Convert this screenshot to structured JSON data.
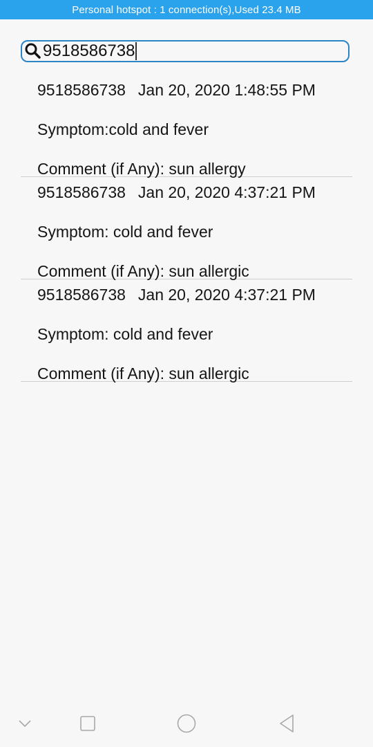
{
  "status_bar": {
    "text": "Personal hotspot : 1 connection(s),Used  23.4 MB",
    "color": "#2aa3ec"
  },
  "search": {
    "icon": "search-icon",
    "value": "9518586738"
  },
  "records": [
    {
      "phone": "9518586738",
      "datetime": "Jan 20, 2020 1:48:55 PM",
      "symptom": "Symptom:cold and fever",
      "comment": "Comment (if Any): sun allergy"
    },
    {
      "phone": "9518586738",
      "datetime": "Jan 20, 2020 4:37:21 PM",
      "symptom": "Symptom: cold and fever",
      "comment": "Comment (if Any): sun allergic"
    },
    {
      "phone": "9518586738",
      "datetime": "Jan 20, 2020 4:37:21 PM",
      "symptom": "Symptom: cold and fever",
      "comment": "Comment (if Any): sun allergic"
    }
  ],
  "nav_bar": {
    "icons": [
      "chevron-down-icon",
      "square-recents-icon",
      "circle-home-icon",
      "triangle-back-icon"
    ]
  }
}
